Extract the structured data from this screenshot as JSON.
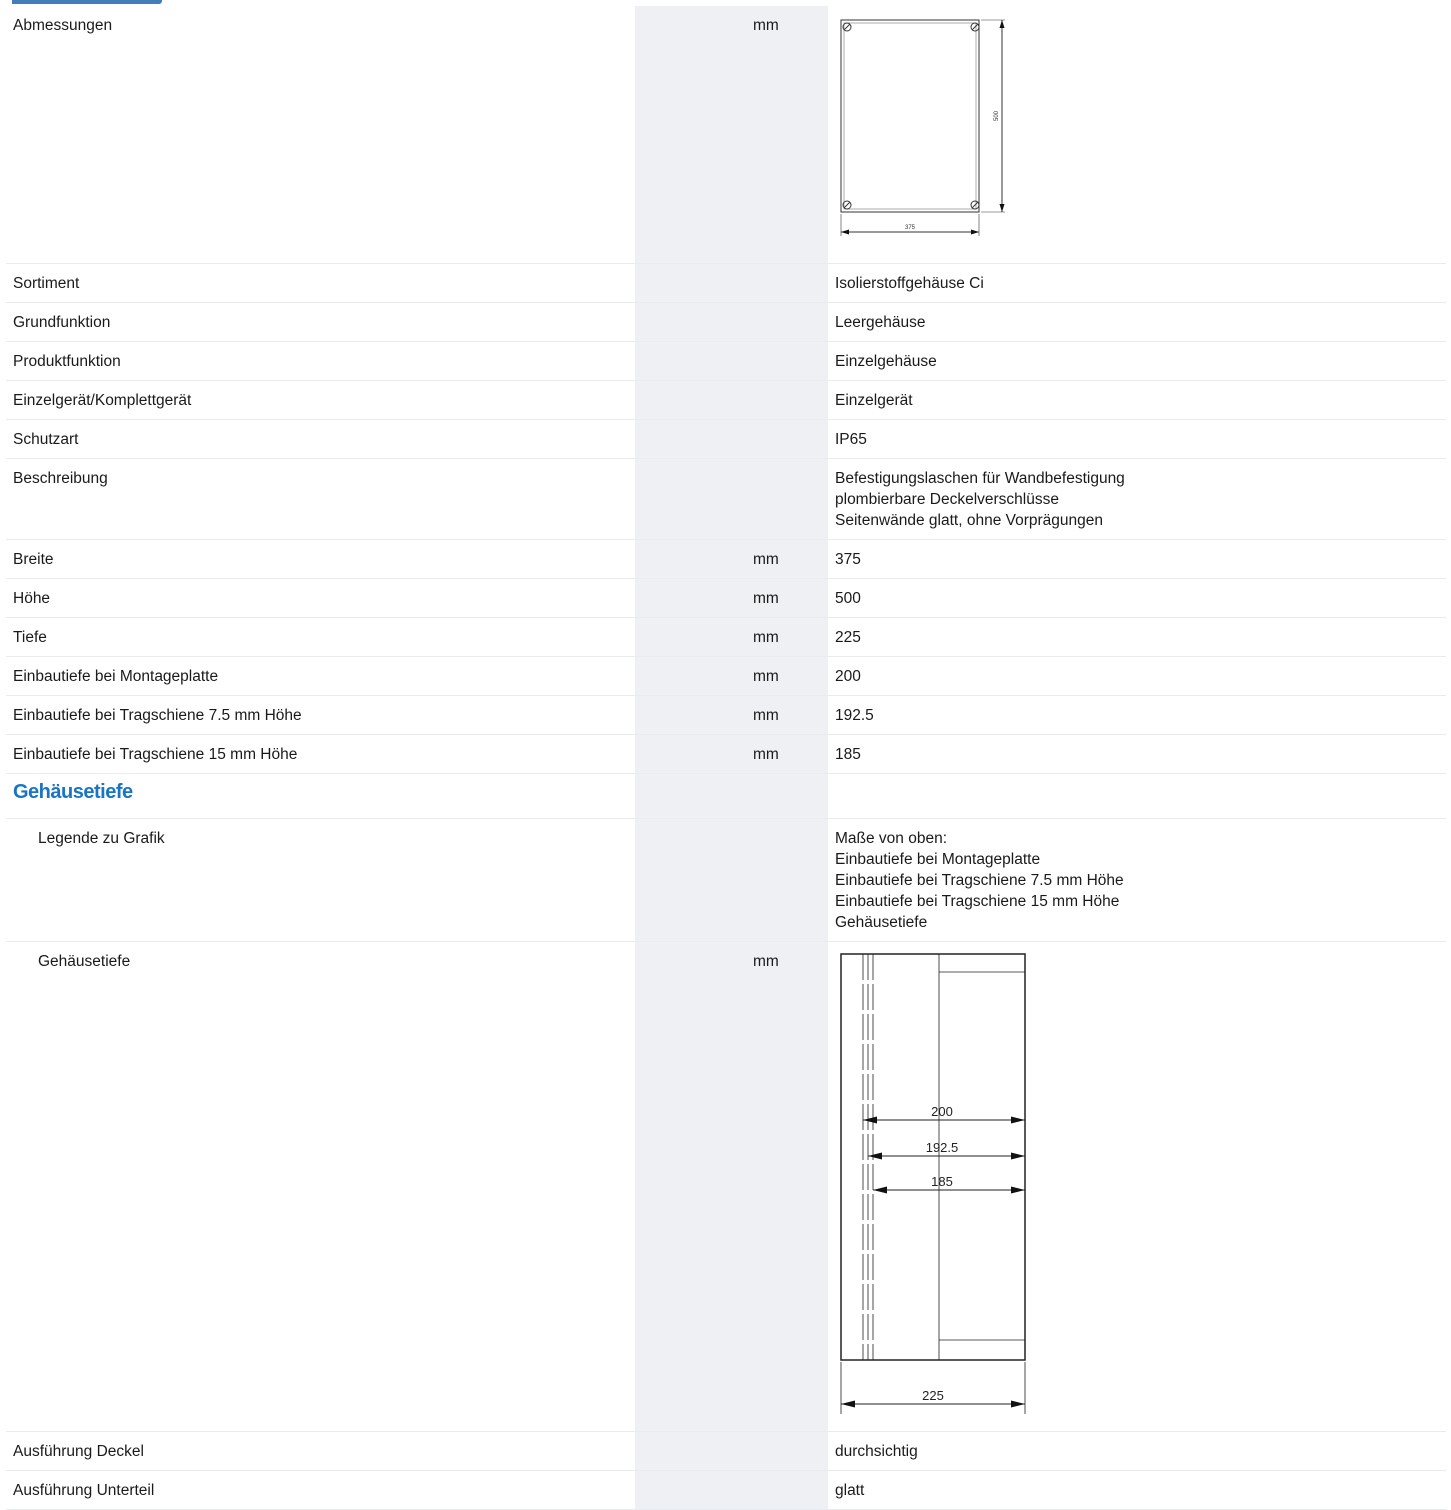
{
  "rows": [
    {
      "label": "Abmessungen",
      "unit": "mm",
      "value": ""
    },
    {
      "label": "Sortiment",
      "unit": "",
      "value": "Isolierstoffgehäuse Ci"
    },
    {
      "label": "Grundfunktion",
      "unit": "",
      "value": "Leergehäuse"
    },
    {
      "label": "Produktfunktion",
      "unit": "",
      "value": "Einzelgehäuse"
    },
    {
      "label": "Einzelgerät/Komplettgerät",
      "unit": "",
      "value": "Einzelgerät"
    },
    {
      "label": "Schutzart",
      "unit": "",
      "value": "IP65"
    },
    {
      "label": "Beschreibung",
      "unit": "",
      "lines": [
        "Befestigungslaschen für Wandbefestigung",
        "plombierbare Deckelverschlüsse",
        "Seitenwände glatt, ohne Vorprägungen"
      ]
    },
    {
      "label": "Breite",
      "unit": "mm",
      "value": "375"
    },
    {
      "label": "Höhe",
      "unit": "mm",
      "value": "500"
    },
    {
      "label": "Tiefe",
      "unit": "mm",
      "value": "225"
    },
    {
      "label": "Einbautiefe bei Montageplatte",
      "unit": "mm",
      "value": "200"
    },
    {
      "label": "Einbautiefe bei Tragschiene 7.5 mm Höhe",
      "unit": "mm",
      "value": "192.5"
    },
    {
      "label": "Einbautiefe bei Tragschiene 15 mm Höhe",
      "unit": "mm",
      "value": "185"
    }
  ],
  "section": {
    "heading": "Gehäusetiefe",
    "legend_label": "Legende zu Grafik",
    "legend_lines": [
      "Maße von oben:",
      "Einbautiefe bei Montageplatte",
      "Einbautiefe bei Tragschiene 7.5 mm Höhe",
      "Einbautiefe bei Tragschiene 15 mm Höhe",
      "Gehäusetiefe"
    ],
    "depth_label": "Gehäusetiefe",
    "depth_unit": "mm"
  },
  "tail_rows": [
    {
      "label": "Ausführung Deckel",
      "unit": "",
      "value": "durchsichtig"
    },
    {
      "label": "Ausführung Unterteil",
      "unit": "",
      "value": "glatt"
    }
  ],
  "drawing_front": {
    "width_label": "375",
    "height_label": "500"
  },
  "drawing_depth": {
    "dim_labels": [
      "200",
      "192.5",
      "185",
      "225"
    ]
  }
}
